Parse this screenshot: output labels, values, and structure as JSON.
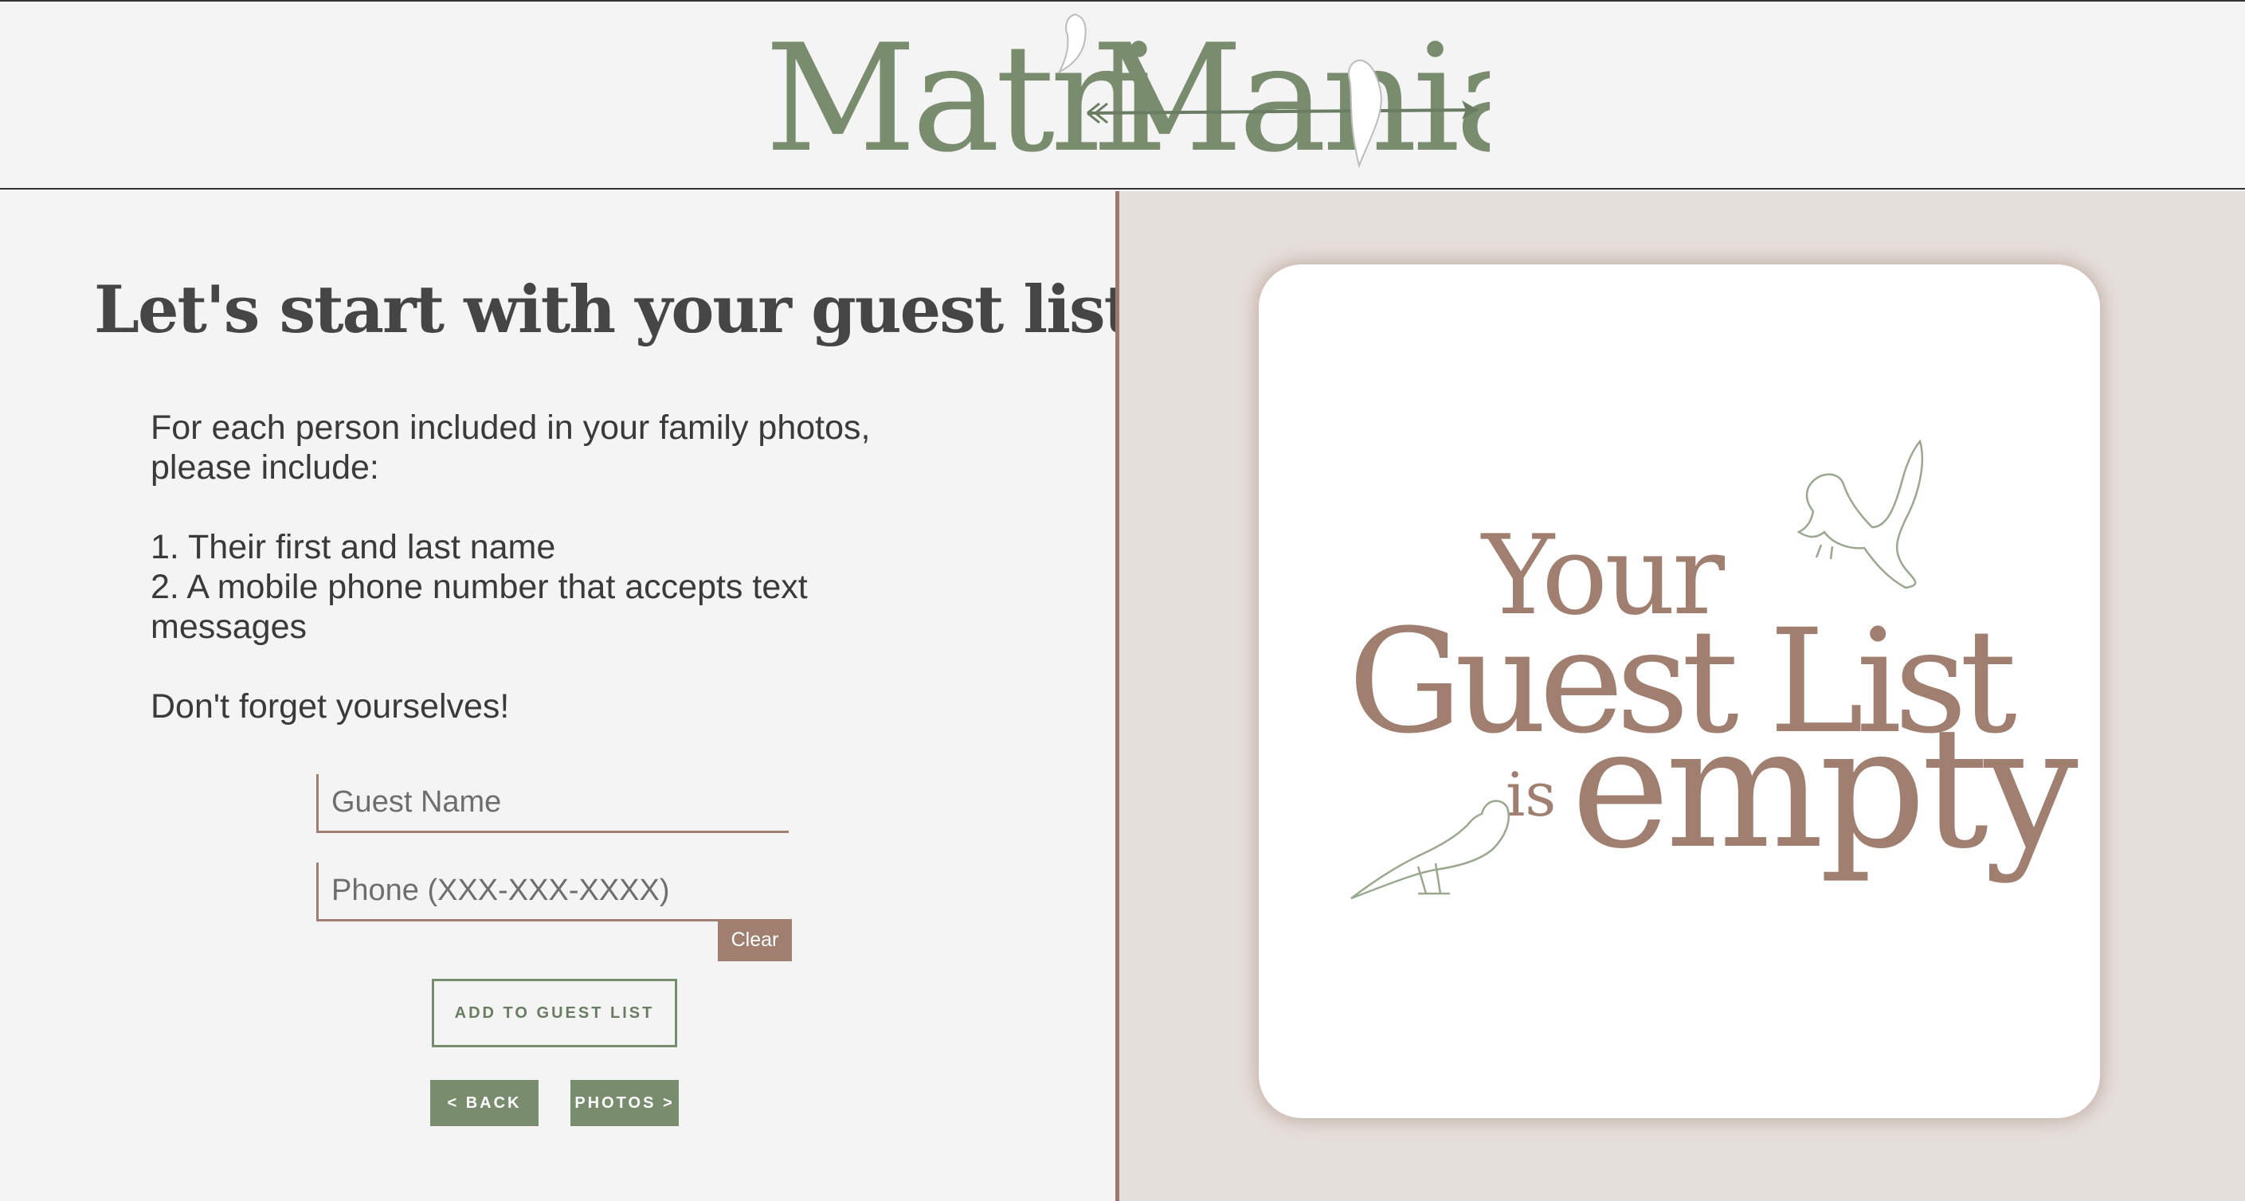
{
  "brand": {
    "name_part1": "Matri",
    "name_part2": "Mania",
    "logo_color": "#7a8c6e"
  },
  "main": {
    "heading": "Let's start with your guest list",
    "intro_line": "For each person included in your family photos, please include:",
    "item_1": "1. Their first and last name",
    "item_2": "2. A mobile phone number that accepts text messages",
    "reminder": "Don't forget yourselves!"
  },
  "form": {
    "name_placeholder": "Guest Name",
    "name_value": "",
    "phone_placeholder": "Phone (XXX-XXX-XXXX)",
    "phone_value": "",
    "clear_label": "Clear",
    "add_label": "ADD TO GUEST LIST",
    "back_label": "< BACK",
    "photos_label": "PHOTOS >"
  },
  "card": {
    "line_your": "Your",
    "line_guest_list": "Guest List",
    "line_is": "is",
    "line_empty": "empty",
    "text_color": "#a07e70"
  },
  "colors": {
    "accent_green": "#7a8c6e",
    "accent_brown": "#a07e70",
    "right_bg": "#e5dfdc"
  }
}
